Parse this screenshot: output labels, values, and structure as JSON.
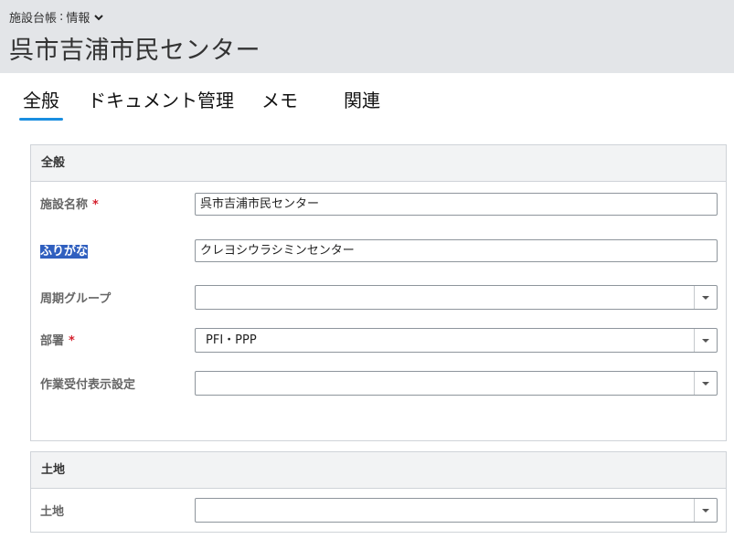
{
  "breadcrumb": {
    "object": "施設台帳",
    "separator": ":",
    "view": "情報"
  },
  "record_title": "呉市吉浦市民センター",
  "tabs": [
    {
      "label": "全般",
      "active": true
    },
    {
      "label": "ドキュメント管理",
      "active": false
    },
    {
      "label": "メモ",
      "active": false
    },
    {
      "label": "関連",
      "active": false
    }
  ],
  "sections": {
    "general": {
      "heading": "全般",
      "fields": {
        "facility_name": {
          "label": "施設名称",
          "value": "呉市吉浦市民センター",
          "required_mark": "*"
        },
        "furigana": {
          "label": "ふりがな",
          "value": "クレヨシウラシミンセンター"
        },
        "cycle_group": {
          "label": "周期グループ",
          "value": ""
        },
        "department": {
          "label": "部署",
          "value": "PFI・PPP",
          "required_mark": "*"
        },
        "work_reception": {
          "label": "作業受付表示設定",
          "value": ""
        }
      }
    },
    "land": {
      "heading": "土地",
      "fields": {
        "land": {
          "label": "土地",
          "value": ""
        }
      }
    }
  },
  "icons": {
    "breadcrumb_dropdown": "chevron-down-icon",
    "select_dropdown": "caret-down-icon"
  },
  "colors": {
    "header_bg": "#e3e5e8",
    "active_tab_underline": "#1a8ee0",
    "required": "#d4202d",
    "selection_highlight": "#2f5fbf"
  }
}
